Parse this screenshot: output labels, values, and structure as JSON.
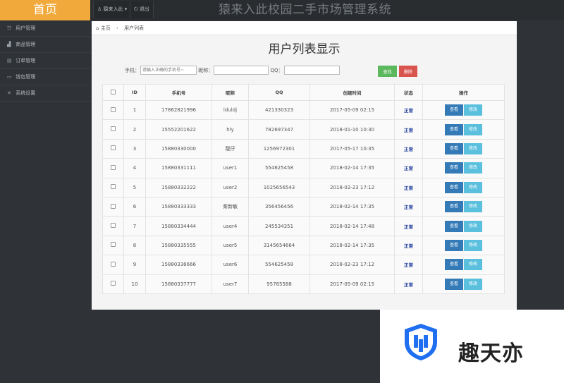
{
  "header": {
    "logo": "首页",
    "user_menu": "猿来入此 ▾",
    "logout": "退出",
    "system_title": "猿来入此校园二手市场管理系统"
  },
  "sidebar": {
    "items": [
      {
        "label": "用户管理",
        "icon": "users-icon"
      },
      {
        "label": "商品管理",
        "icon": "chart-icon"
      },
      {
        "label": "订单管理",
        "icon": "list-icon"
      },
      {
        "label": "钱包管理",
        "icon": "wallet-icon"
      },
      {
        "label": "系统设置",
        "icon": "settings-icon"
      }
    ]
  },
  "breadcrumb": {
    "home": "主页",
    "current": "用户列表"
  },
  "page_title": "用户列表显示",
  "search": {
    "phone_label": "手机：",
    "phone_placeholder": "请输入正确的手机号~",
    "nickname_label": "昵称：",
    "qq_label": "QQ：",
    "find_button": "查找",
    "delete_button": "删除"
  },
  "table": {
    "columns": [
      "ID",
      "手机号",
      "昵称",
      "QQ",
      "创建时间",
      "状态",
      "操作"
    ],
    "view_label": "查看",
    "edit_label": "修改",
    "rows": [
      {
        "id": "1",
        "phone": "17862821996",
        "nickname": "lduldj",
        "qq": "421330323",
        "created": "2017-05-09 02:15",
        "status": "正常"
      },
      {
        "id": "2",
        "phone": "15552201622",
        "nickname": "hly",
        "qq": "782697347",
        "created": "2018-01-10 10:30",
        "status": "正常"
      },
      {
        "id": "3",
        "phone": "15880330000",
        "nickname": "靓仔",
        "qq": "1256972301",
        "created": "2017-05-17 10:35",
        "status": "正常"
      },
      {
        "id": "4",
        "phone": "15880331111",
        "nickname": "user1",
        "qq": "554625458",
        "created": "2018-02-14 17:35",
        "status": "正常"
      },
      {
        "id": "5",
        "phone": "15880332222",
        "nickname": "user2",
        "qq": "1025656543",
        "created": "2018-02-23 17:12",
        "status": "正常"
      },
      {
        "id": "6",
        "phone": "15880333333",
        "nickname": "秦新敏",
        "qq": "356456456",
        "created": "2018-02-14 17:35",
        "status": "正常"
      },
      {
        "id": "7",
        "phone": "15880334444",
        "nickname": "user4",
        "qq": "245534351",
        "created": "2018-02-14 17:48",
        "status": "正常"
      },
      {
        "id": "8",
        "phone": "15880335555",
        "nickname": "user5",
        "qq": "3145654664",
        "created": "2018-02-14 17:35",
        "status": "正常"
      },
      {
        "id": "9",
        "phone": "15880336666",
        "nickname": "user6",
        "qq": "554625458",
        "created": "2018-02-23 17:12",
        "status": "正常"
      },
      {
        "id": "10",
        "phone": "15880337777",
        "nickname": "user7",
        "qq": "95785588",
        "created": "2017-05-09 02:15",
        "status": "正常"
      }
    ]
  },
  "watermark": {
    "text": "趣天亦"
  },
  "colors": {
    "logo_bg": "#f0a93a",
    "find_button": "#5cb85c",
    "delete_button": "#d9534f",
    "view_button": "#337ab7",
    "edit_button": "#5bc0de"
  }
}
